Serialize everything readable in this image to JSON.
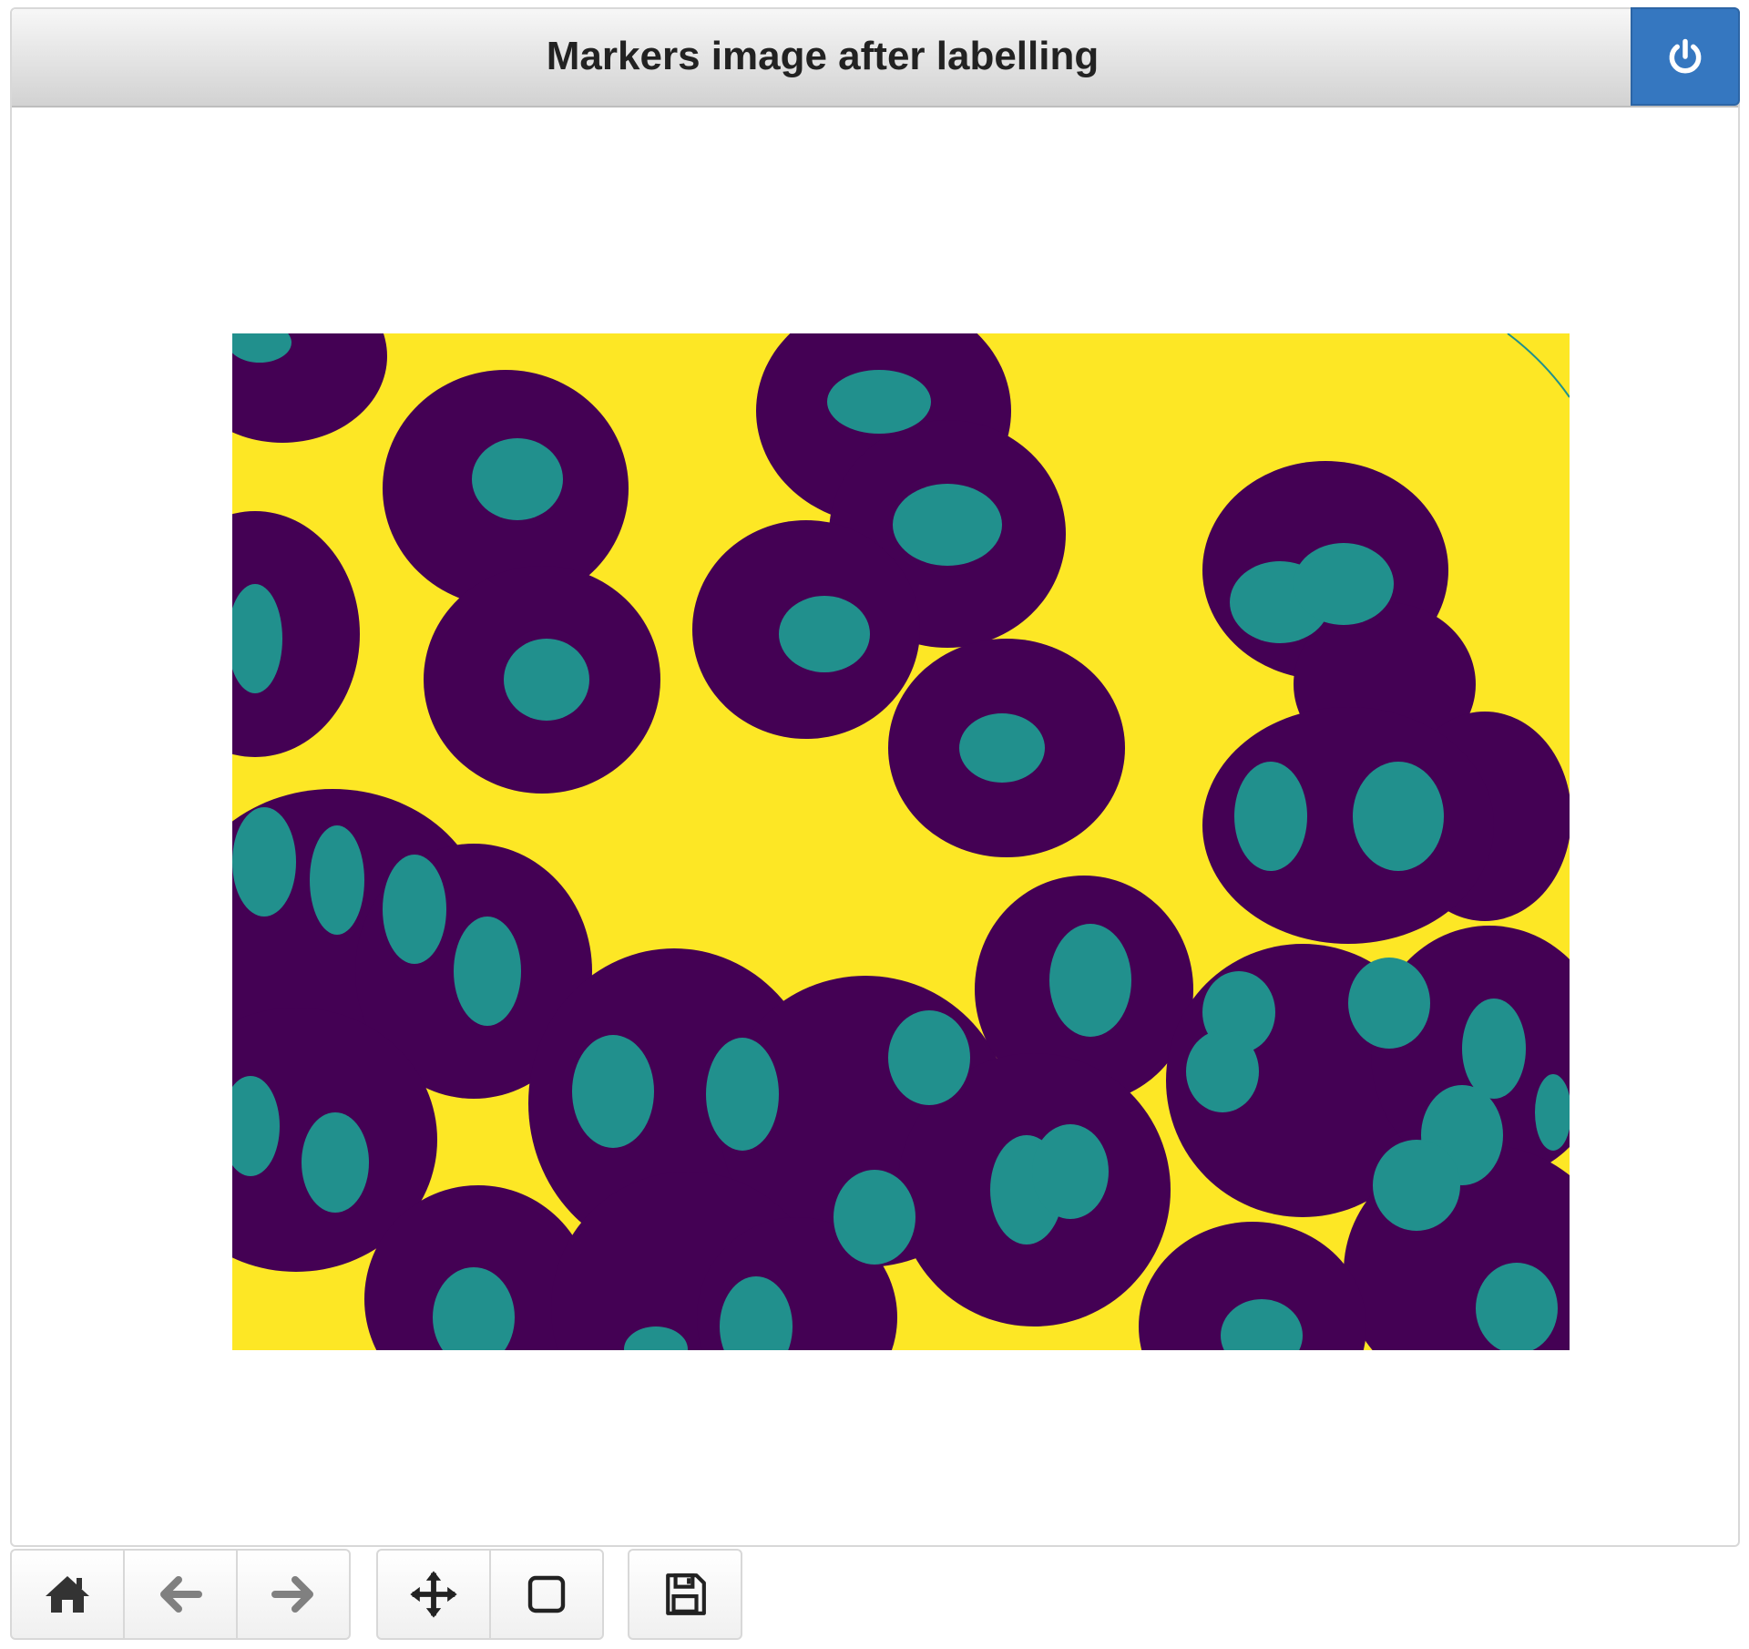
{
  "window": {
    "title": "Markers image after labelling",
    "close_icon": "power-icon",
    "accent_color": "#3577c0"
  },
  "figure": {
    "colormap": "viridis",
    "colors": {
      "background": "#fde725",
      "ring": "#440154",
      "marker": "#21908d"
    }
  },
  "toolbar": {
    "groups": [
      [
        "home-icon",
        "arrow-left-icon",
        "arrow-right-icon"
      ],
      [
        "move-icon",
        "square-icon"
      ],
      [
        "floppy-disk-icon"
      ]
    ]
  }
}
